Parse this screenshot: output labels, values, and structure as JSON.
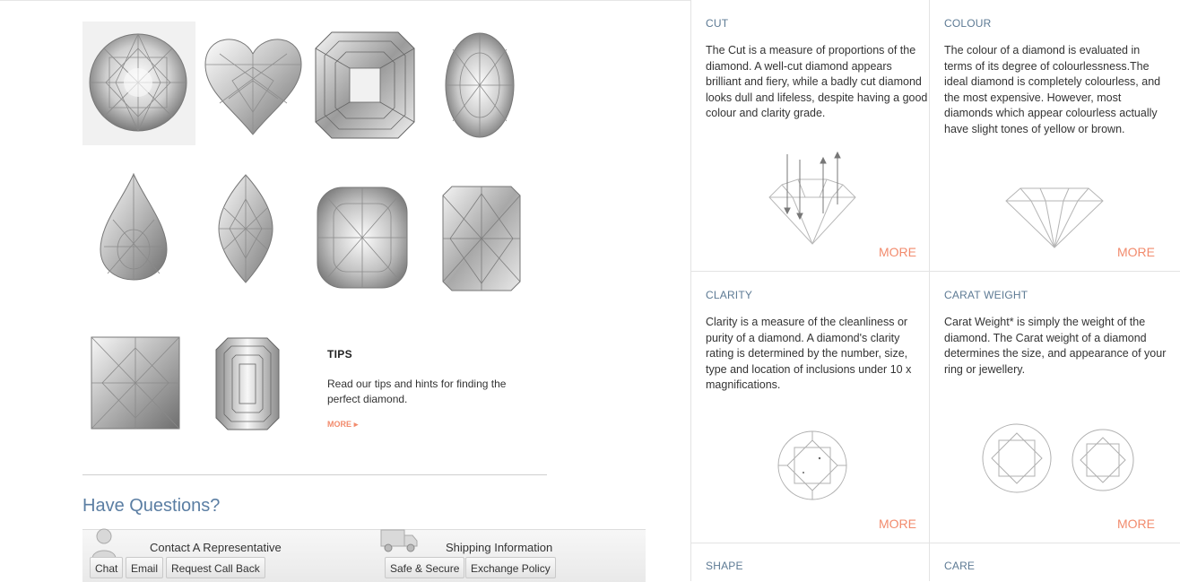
{
  "gems": [
    {
      "icon": "round-diamond-icon"
    },
    {
      "icon": "heart-diamond-icon"
    },
    {
      "icon": "asscher-diamond-icon"
    },
    {
      "icon": "oval-diamond-icon"
    },
    {
      "icon": "pear-diamond-icon"
    },
    {
      "icon": "marquise-diamond-icon"
    },
    {
      "icon": "cushion-diamond-icon"
    },
    {
      "icon": "radiant-diamond-icon"
    },
    {
      "icon": "princess-diamond-icon"
    },
    {
      "icon": "emerald-diamond-icon"
    }
  ],
  "tips": {
    "title": "TIPS",
    "text": "Read our tips and hints for finding the perfect diamond.",
    "more": "MORE"
  },
  "questions": {
    "title": "Have Questions?",
    "contact_label": "Contact A Representative",
    "shipping_label": "Shipping Information",
    "buttons": {
      "chat": "Chat",
      "email": "Email",
      "callback": "Request Call Back",
      "secure": "Safe & Secure",
      "exchange": "Exchange Policy"
    }
  },
  "info": {
    "cut": {
      "title": "CUT",
      "text": "The Cut is a measure of proportions of the diamond. A well-cut diamond appears brilliant and fiery, while a badly cut diamond looks dull and lifeless, despite having a good colour and clarity grade.",
      "more": "MORE"
    },
    "colour": {
      "title": "COLOUR",
      "text": "The colour of a diamond is evaluated in terms of its degree of colourlessness.The ideal diamond is completely colourless, and the most expensive. However, most diamonds which appear colourless actually have slight tones of yellow or brown.",
      "more": "MORE"
    },
    "clarity": {
      "title": "CLARITY",
      "text": "Clarity is a measure of the cleanliness or purity of a diamond. A diamond's clarity rating is determined by the number, size, type and location of inclusions under 10 x magnifications.",
      "more": "MORE"
    },
    "carat": {
      "title": "CARAT WEIGHT",
      "text": "Carat Weight* is simply the weight of the diamond. The Carat weight of a diamond determines the size, and appearance of your ring or jewellery.",
      "more": "MORE"
    },
    "shape": {
      "title": "SHAPE"
    },
    "care": {
      "title": "CARE"
    }
  },
  "colors": {
    "accent_more": "#f28b6d",
    "heading_blue": "#5b7ea3",
    "cell_title": "#5d7a94"
  }
}
